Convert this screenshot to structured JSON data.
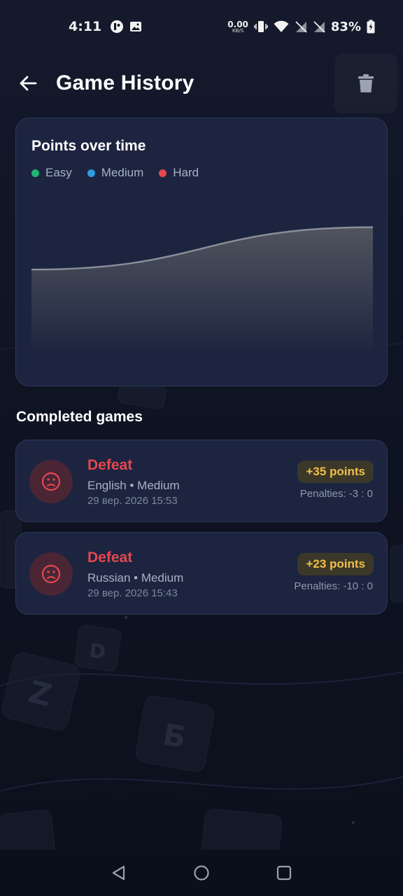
{
  "status_bar": {
    "time": "4:11",
    "net_speed_value": "0.00",
    "net_speed_unit": "KB/S",
    "battery": "83%"
  },
  "app_bar": {
    "title": "Game History",
    "back_icon": "arrow-left-icon",
    "delete_icon": "trash-icon"
  },
  "chart_card": {
    "title": "Points over time",
    "legend": [
      {
        "label": "Easy",
        "color": "#22b573"
      },
      {
        "label": "Medium",
        "color": "#2f9be0"
      },
      {
        "label": "Hard",
        "color": "#e5474f"
      }
    ]
  },
  "chart_data": {
    "type": "area",
    "title": "Points over time",
    "series": [
      {
        "name": "Medium",
        "values": [
          23,
          35
        ]
      }
    ],
    "legend": [
      "Easy",
      "Medium",
      "Hard"
    ],
    "legend_position": "top-left",
    "grid": false,
    "colors": {
      "line": "#8a8e99",
      "fill_top": "#4c5060",
      "fill_bottom": "#1e2640"
    }
  },
  "games_section": {
    "title": "Completed games",
    "games": [
      {
        "result": "Defeat",
        "meta": "English • Medium",
        "date": "29 вер. 2026 15:53",
        "points": "+35 points",
        "penalties": "Penalties: -3 : 0",
        "icon": "sad-face-icon"
      },
      {
        "result": "Defeat",
        "meta": "Russian • Medium",
        "date": "29 вер. 2026 15:43",
        "points": "+23 points",
        "penalties": "Penalties: -10 : 0",
        "icon": "sad-face-icon"
      }
    ]
  },
  "colors": {
    "background": "#0d1220",
    "card": "#1c2440",
    "defeat": "#e5474f",
    "points": "#f2bf45"
  },
  "nav_bar": {
    "back_icon": "nav-back-icon",
    "home_icon": "nav-home-icon",
    "recents_icon": "nav-recents-icon"
  }
}
